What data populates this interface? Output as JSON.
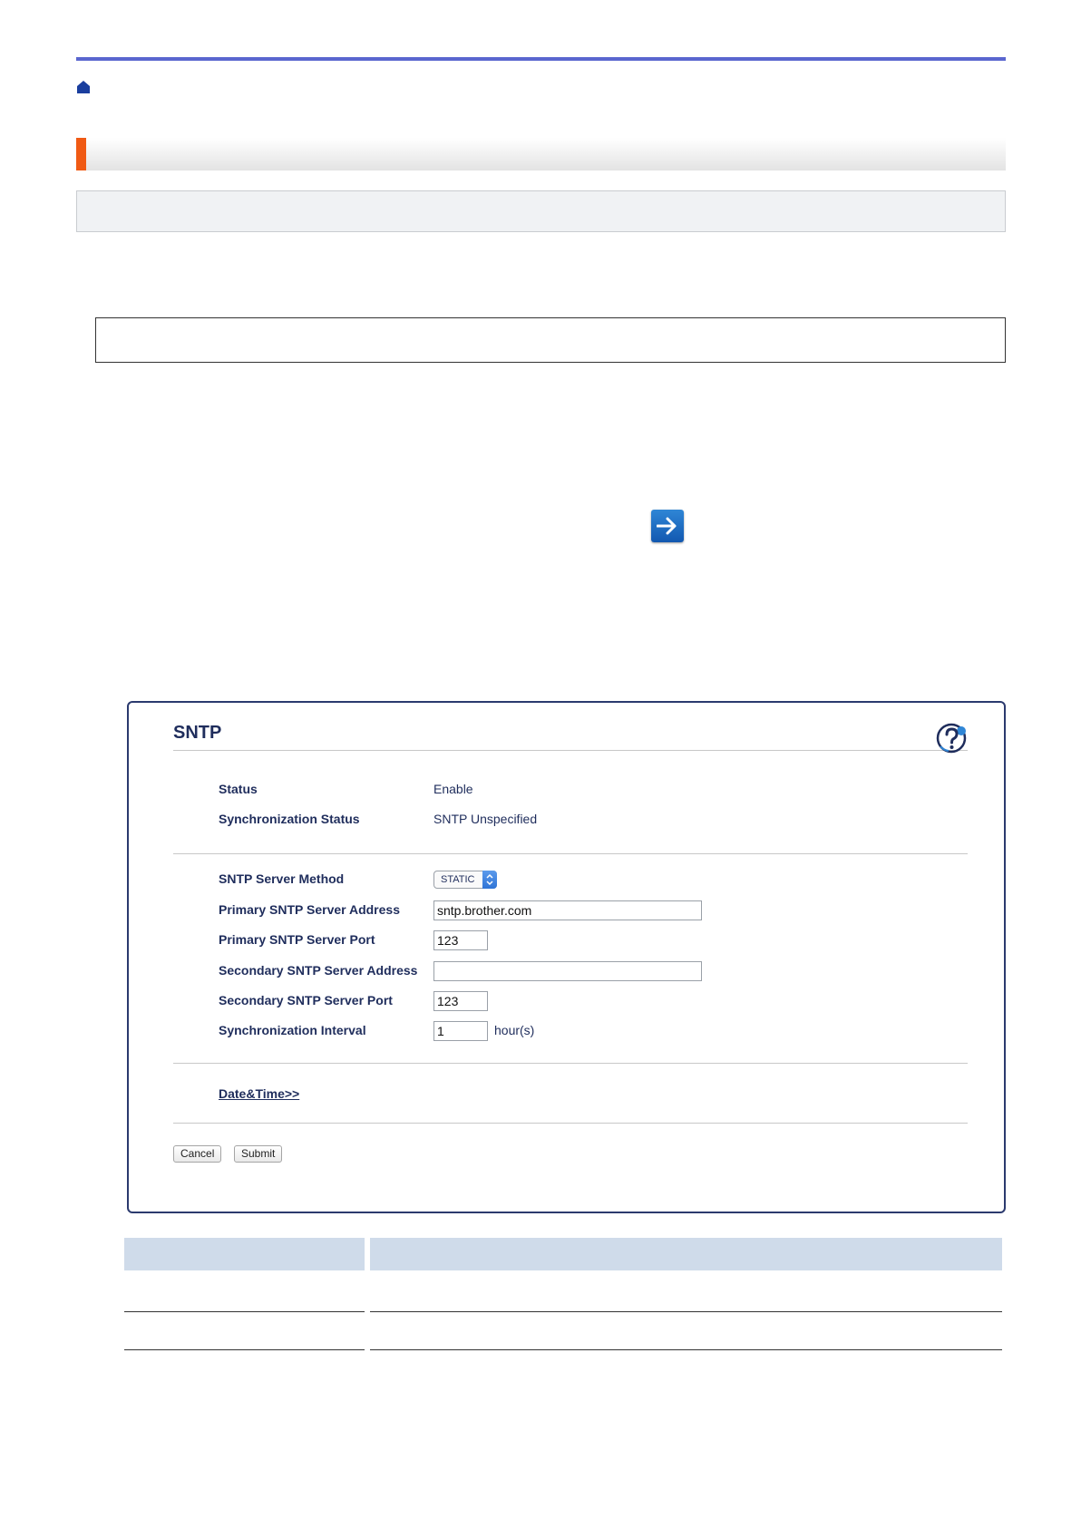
{
  "panel": {
    "title": "SNTP",
    "status": {
      "label": "Status",
      "value": "Enable"
    },
    "sync_status": {
      "label": "Synchronization Status",
      "value": "SNTP Unspecified"
    },
    "server_method": {
      "label": "SNTP Server Method",
      "value": "STATIC"
    },
    "primary_address": {
      "label": "Primary SNTP Server Address",
      "value": "sntp.brother.com"
    },
    "primary_port": {
      "label": "Primary SNTP Server Port",
      "value": "123"
    },
    "secondary_address": {
      "label": "Secondary SNTP Server Address",
      "value": ""
    },
    "secondary_port": {
      "label": "Secondary SNTP Server Port",
      "value": "123"
    },
    "sync_interval": {
      "label": "Synchronization Interval",
      "value": "1",
      "unit": "hour(s)"
    },
    "date_time_link": "Date&Time>>",
    "cancel_label": "Cancel",
    "submit_label": "Submit"
  },
  "colors": {
    "accent_rule": "#5a66cf",
    "heading_accent": "#f05a14",
    "panel_text": "#1f2d5c",
    "table_header": "#cfdbea"
  },
  "icons": [
    "home-icon",
    "arrow-right-icon",
    "help-icon",
    "select-chevron-icon"
  ]
}
